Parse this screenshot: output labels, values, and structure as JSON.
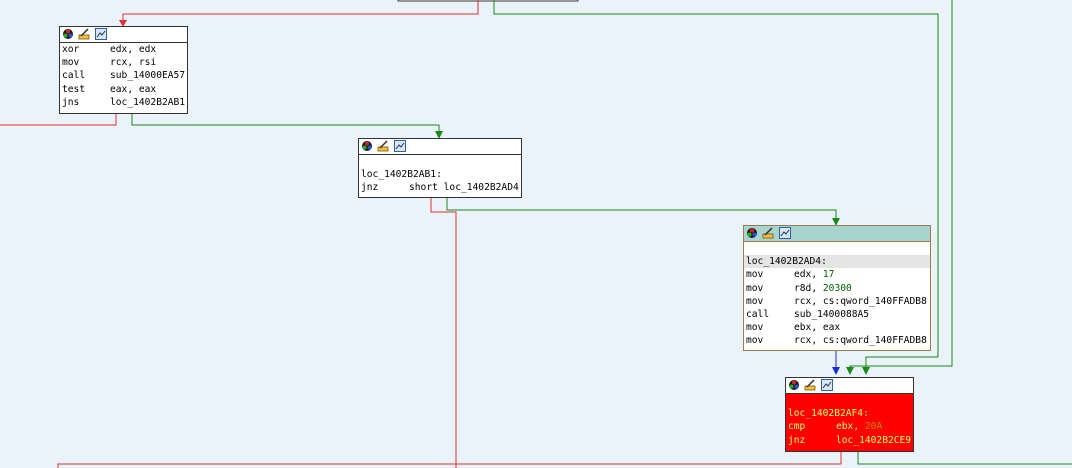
{
  "nodes": {
    "block_a": {
      "lines": [
        {
          "mnemonic": "xor",
          "operands": "edx, edx"
        },
        {
          "mnemonic": "mov",
          "operands": "rcx, rsi"
        },
        {
          "mnemonic": "call",
          "operands": "sub_14000EA57"
        },
        {
          "mnemonic": "test",
          "operands": "eax, eax"
        },
        {
          "mnemonic": "jns",
          "operands": "loc_1402B2AB1"
        }
      ]
    },
    "block_b": {
      "label": "loc_1402B2AB1:",
      "lines": [
        {
          "mnemonic": "jnz",
          "operands": "short loc_1402B2AD4"
        }
      ]
    },
    "block_c": {
      "label": "loc_1402B2AD4:",
      "lines": [
        {
          "mnemonic": "mov",
          "operands_a": "edx, ",
          "num": "17",
          "operands_b": ""
        },
        {
          "mnemonic": "mov",
          "operands_a": "r8d, ",
          "num": "20300",
          "operands_b": ""
        },
        {
          "mnemonic": "mov",
          "operands_a": "rcx, cs:qword_140FFADB8",
          "num": "",
          "operands_b": ""
        },
        {
          "mnemonic": "call",
          "operands_a": "sub_1400088A5",
          "num": "",
          "operands_b": ""
        },
        {
          "mnemonic": "mov",
          "operands_a": "ebx, eax",
          "num": "",
          "operands_b": ""
        },
        {
          "mnemonic": "mov",
          "operands_a": "rcx, cs:qword_140FFADB8",
          "num": "",
          "operands_b": ""
        }
      ]
    },
    "block_d": {
      "label": "loc_1402B2AF4:",
      "lines": [
        {
          "mnemonic": "cmp",
          "operands_a": "ebx, ",
          "num": "20A"
        },
        {
          "mnemonic": "jnz",
          "operands_a": "loc_1402B2CE9",
          "num": ""
        }
      ]
    }
  },
  "colors": {
    "background": "#eaf3fa",
    "edge_false": "#e03030",
    "edge_true": "#1a8a1a",
    "edge_uncond": "#1a30d0",
    "highlight_block": "#ff0000",
    "selected_header": "#a8d4d0"
  },
  "icons": {
    "header": [
      "color-node-icon",
      "rename-node-icon",
      "graph-overview-icon"
    ]
  }
}
